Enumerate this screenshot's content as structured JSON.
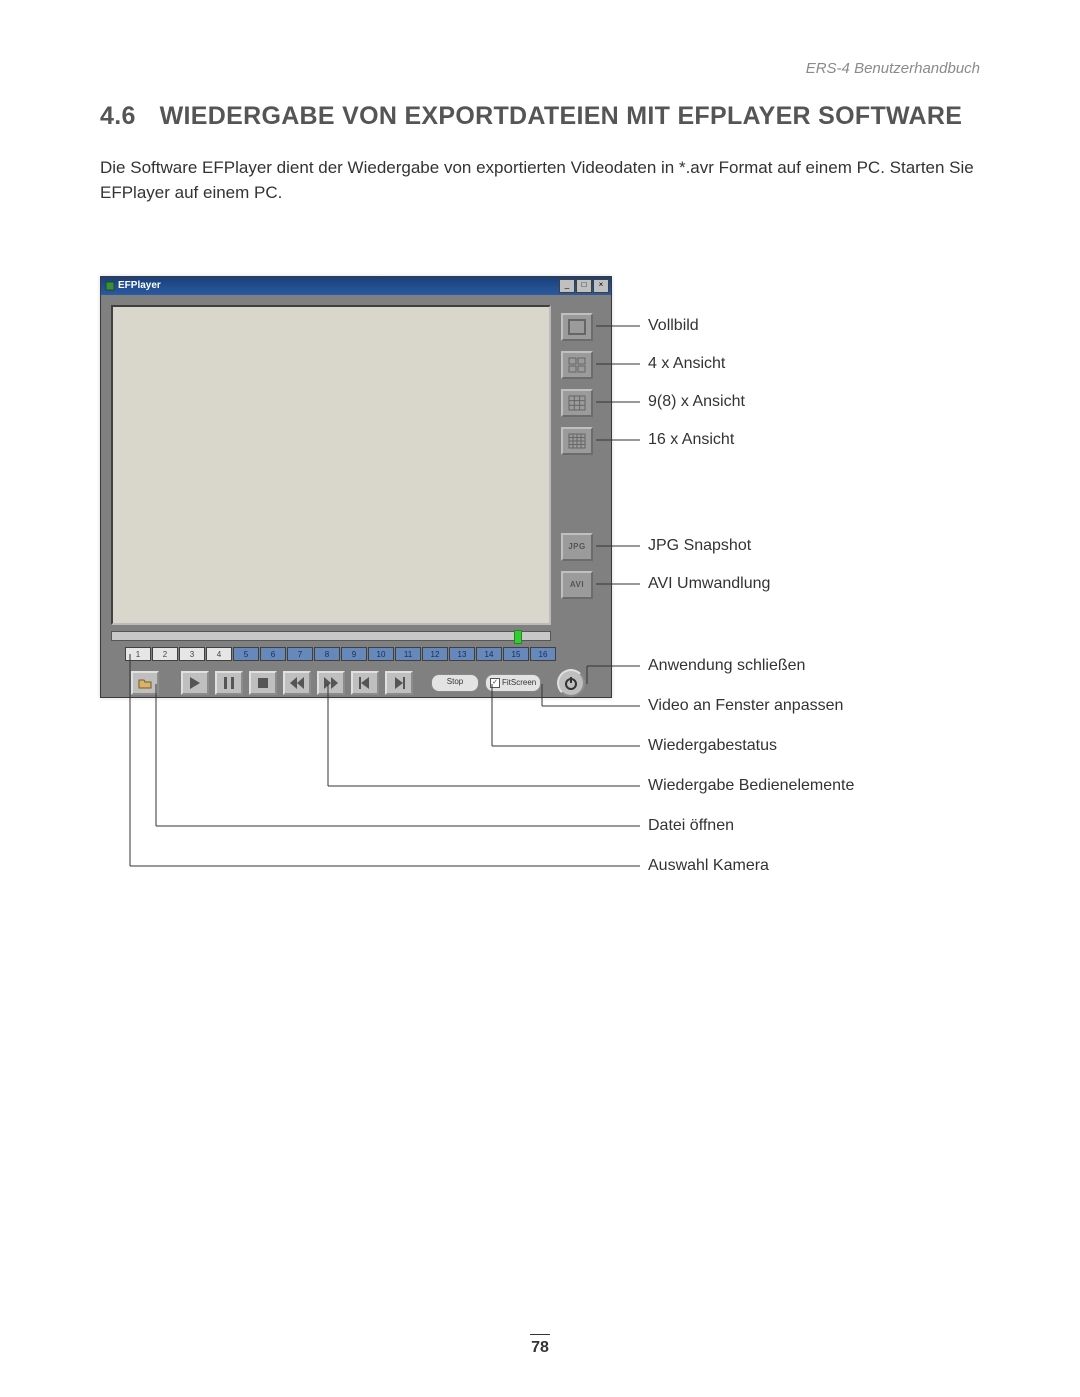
{
  "doc_header": "ERS-4 Benutzerhandbuch",
  "section": {
    "number": "4.6",
    "title": "WIEDERGABE VON EXPORTDATEIEN MIT EFPLAYER SOFTWARE"
  },
  "body": "Die Software EFPlayer dient der Wiedergabe von exportierten Videodaten in *.avr Format auf einem PC. Starten Sie EFPlayer auf einem PC.",
  "app": {
    "title": "EFPlayer",
    "status": "Stop",
    "fit_label": "FitScreen",
    "fit_checked": "✓",
    "side_buttons": {
      "jpg": "JPG",
      "avi": "AVI"
    },
    "cameras": [
      "1",
      "2",
      "3",
      "4",
      "5",
      "6",
      "7",
      "8",
      "9",
      "10",
      "11",
      "12",
      "13",
      "14",
      "15",
      "16"
    ]
  },
  "labels": {
    "vollbild": "Vollbild",
    "view4": "4 x Ansicht",
    "view9": "9(8) x Ansicht",
    "view16": "16 x Ansicht",
    "jpg": "JPG Snapshot",
    "avi": "AVI Umwandlung",
    "close": "Anwendung schließen",
    "fit": "Video an Fenster anpassen",
    "status": "Wiedergabestatus",
    "playback": "Wiedergabe Bedienelemente",
    "open": "Datei öffnen",
    "camera": "Auswahl Kamera"
  },
  "page_number": "78"
}
